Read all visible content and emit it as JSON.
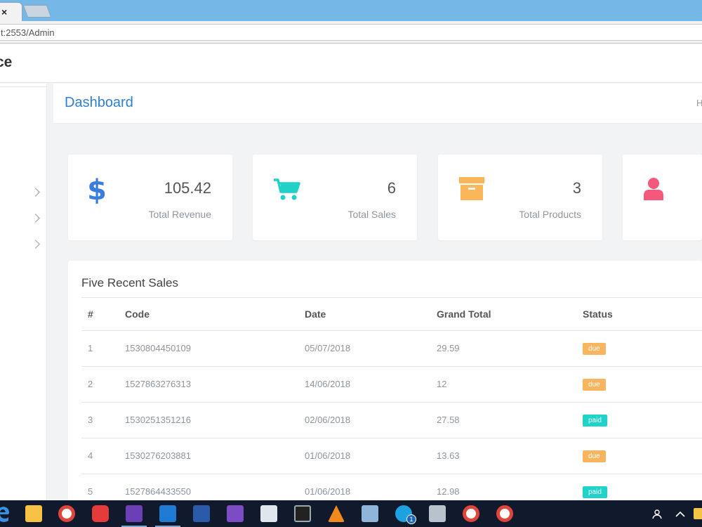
{
  "browser": {
    "tab_close": "×",
    "url": "t:2553/Admin"
  },
  "app": {
    "brand_fragment": "ce"
  },
  "page": {
    "title": "Dashboard",
    "breadcrumb_home": "H"
  },
  "stats": [
    {
      "icon": "dollar-icon",
      "value": "105.42",
      "label": "Total Revenue",
      "color": "#3b7ddd"
    },
    {
      "icon": "cart-icon",
      "value": "6",
      "label": "Total Sales",
      "color": "#1fd1c6"
    },
    {
      "icon": "archive-box-icon",
      "value": "3",
      "label": "Total Products",
      "color": "#fbb65a"
    },
    {
      "icon": "user-icon",
      "value": "",
      "label": "",
      "color": "#f5587b"
    }
  ],
  "recent_sales": {
    "title": "Five Recent Sales",
    "columns": [
      "#",
      "Code",
      "Date",
      "Grand Total",
      "Status"
    ],
    "rows": [
      {
        "num": "1",
        "code": "1530804450109",
        "date": "05/07/2018",
        "total": "29.59",
        "status": "due"
      },
      {
        "num": "2",
        "code": "1527863276313",
        "date": "14/06/2018",
        "total": "12",
        "status": "due"
      },
      {
        "num": "3",
        "code": "1530251351216",
        "date": "02/06/2018",
        "total": "27.58",
        "status": "paid"
      },
      {
        "num": "4",
        "code": "1530276203881",
        "date": "01/06/2018",
        "total": "13.63",
        "status": "due"
      },
      {
        "num": "5",
        "code": "1527864433550",
        "date": "01/06/2018",
        "total": "12.98",
        "status": "paid"
      }
    ]
  },
  "status_colors": {
    "due": "#f9b55e",
    "paid": "#1ed3c9"
  },
  "taskbar": {
    "skype_badge": "1"
  }
}
